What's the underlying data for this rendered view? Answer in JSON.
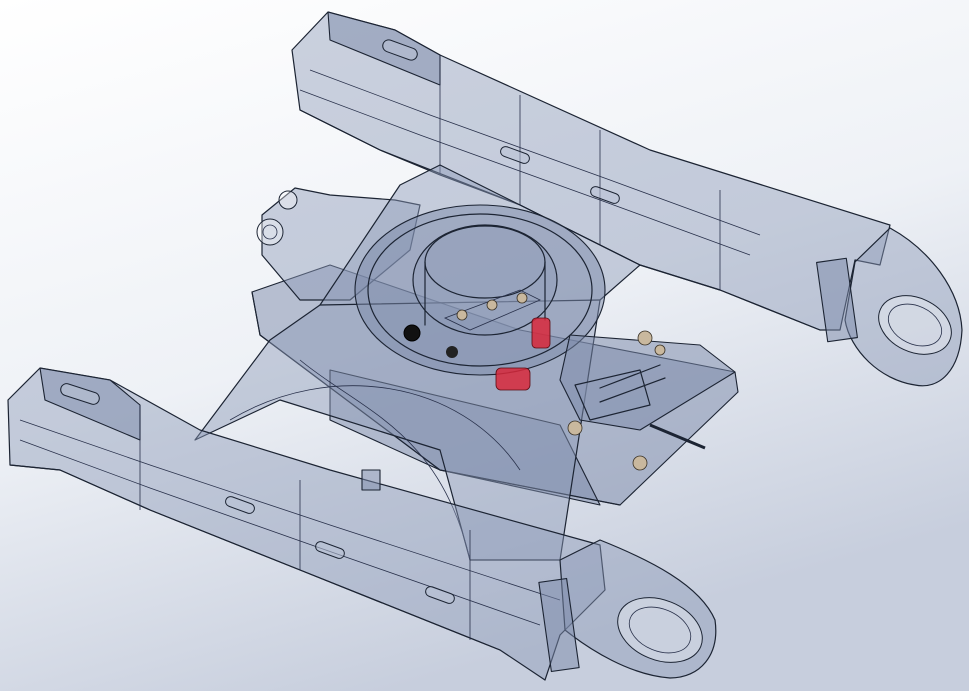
{
  "viewport": {
    "background_top": "#ffffff",
    "background_bottom": "#c7cedd",
    "body_color": "#8f9bb8",
    "edge_color": "#1c2433",
    "highlight_color": "#d8283b",
    "bolt_color": "#c9b89e"
  }
}
